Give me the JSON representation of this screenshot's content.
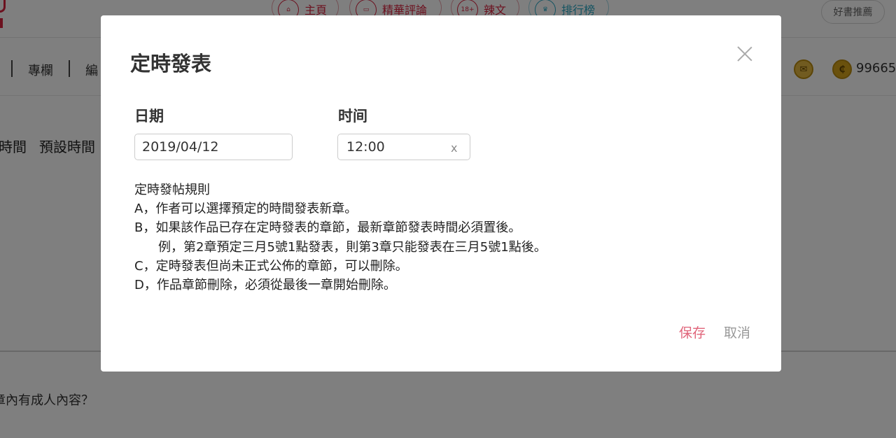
{
  "topnav": {
    "home_label": "主頁",
    "review_label": "精華評論",
    "hot_label": "辣文",
    "hot_badge": "18+",
    "rank_label": "排行榜",
    "recommend_label": "好書推薦"
  },
  "subnav": {
    "column_label": "專欄",
    "edit_label_partial": "編"
  },
  "wallet": {
    "coin_symbol": "₵",
    "balance": "99665"
  },
  "background": {
    "time_label_partial": "時間",
    "default_time_label_partial": "預設時間",
    "adult_question_partial": "章內有成人內容？"
  },
  "modal": {
    "title": "定時發表",
    "date_label": "日期",
    "time_label": "时间",
    "date_value": "2019/04/12",
    "time_value": "12:00",
    "clear_label": "x",
    "rules": [
      "定時發帖規則",
      "A，作者可以選擇預定的時間發表新章。",
      "B，如果該作品已存在定時發表的章節，最新章節發表時間必須置後。",
      "例，第2章預定三月5號1點發表，則第3章只能發表在三月5號1點後。",
      "C，定時發表但尚未正式公佈的章節，可以刪除。",
      "D，作品章節刪除，必須從最後一章開始刪除。"
    ],
    "save_label": "保存",
    "cancel_label": "取消"
  },
  "colors": {
    "accent": "#e0647a",
    "brand_red": "#d9233f",
    "rank_blue": "#2aa8c4"
  }
}
